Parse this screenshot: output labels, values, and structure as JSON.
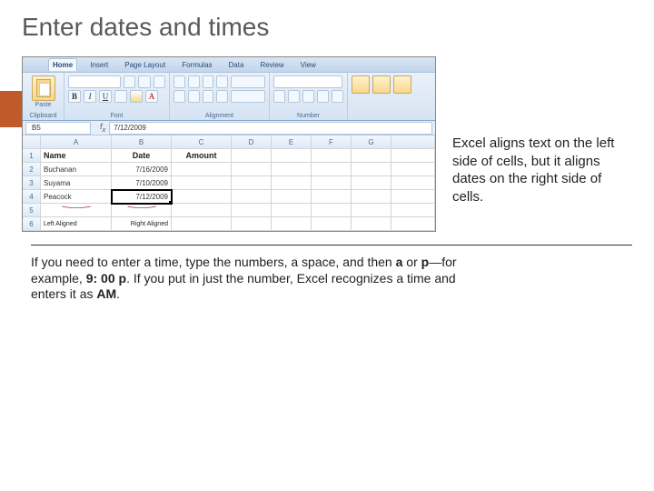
{
  "title": "Enter dates and times",
  "ribbon": {
    "tabs": [
      "Home",
      "Insert",
      "Page Layout",
      "Formulas",
      "Data",
      "Review",
      "View"
    ],
    "activeTab": "Home",
    "groups": {
      "clipboard": "Clipboard",
      "font": "Font",
      "alignment": "Alignment",
      "number": "Number",
      "paste": "Paste"
    }
  },
  "namebox": "B5",
  "formula": "7/12/2009",
  "columns": [
    "A",
    "B",
    "C",
    "D",
    "E",
    "F",
    "G"
  ],
  "headers": {
    "a": "Name",
    "b": "Date",
    "c": "Amount"
  },
  "rows": [
    {
      "n": "1"
    },
    {
      "n": "2",
      "a": "Buchanan",
      "b": "7/16/2009"
    },
    {
      "n": "3",
      "a": "Suyama",
      "b": "7/10/2009"
    },
    {
      "n": "4",
      "a": "Peacock",
      "b": "7/12/2009"
    },
    {
      "n": "5"
    },
    {
      "n": "6"
    }
  ],
  "annotations": {
    "left": "Left Aligned",
    "right": "Right Aligned"
  },
  "sideText": "Excel aligns text on the left side of cells, but it aligns dates on the right side of cells.",
  "bodyText": {
    "p1a": "If you need to enter a time, type the numbers, a space, and then ",
    "p1b": "a",
    "p1c": " or ",
    "p1d": "p",
    "p1e": "—for example, ",
    "p1f": "9: 00 p",
    "p1g": ". If you put in just the number, Excel recognizes a time and enters it as ",
    "p1h": "AM",
    "p1i": "."
  }
}
